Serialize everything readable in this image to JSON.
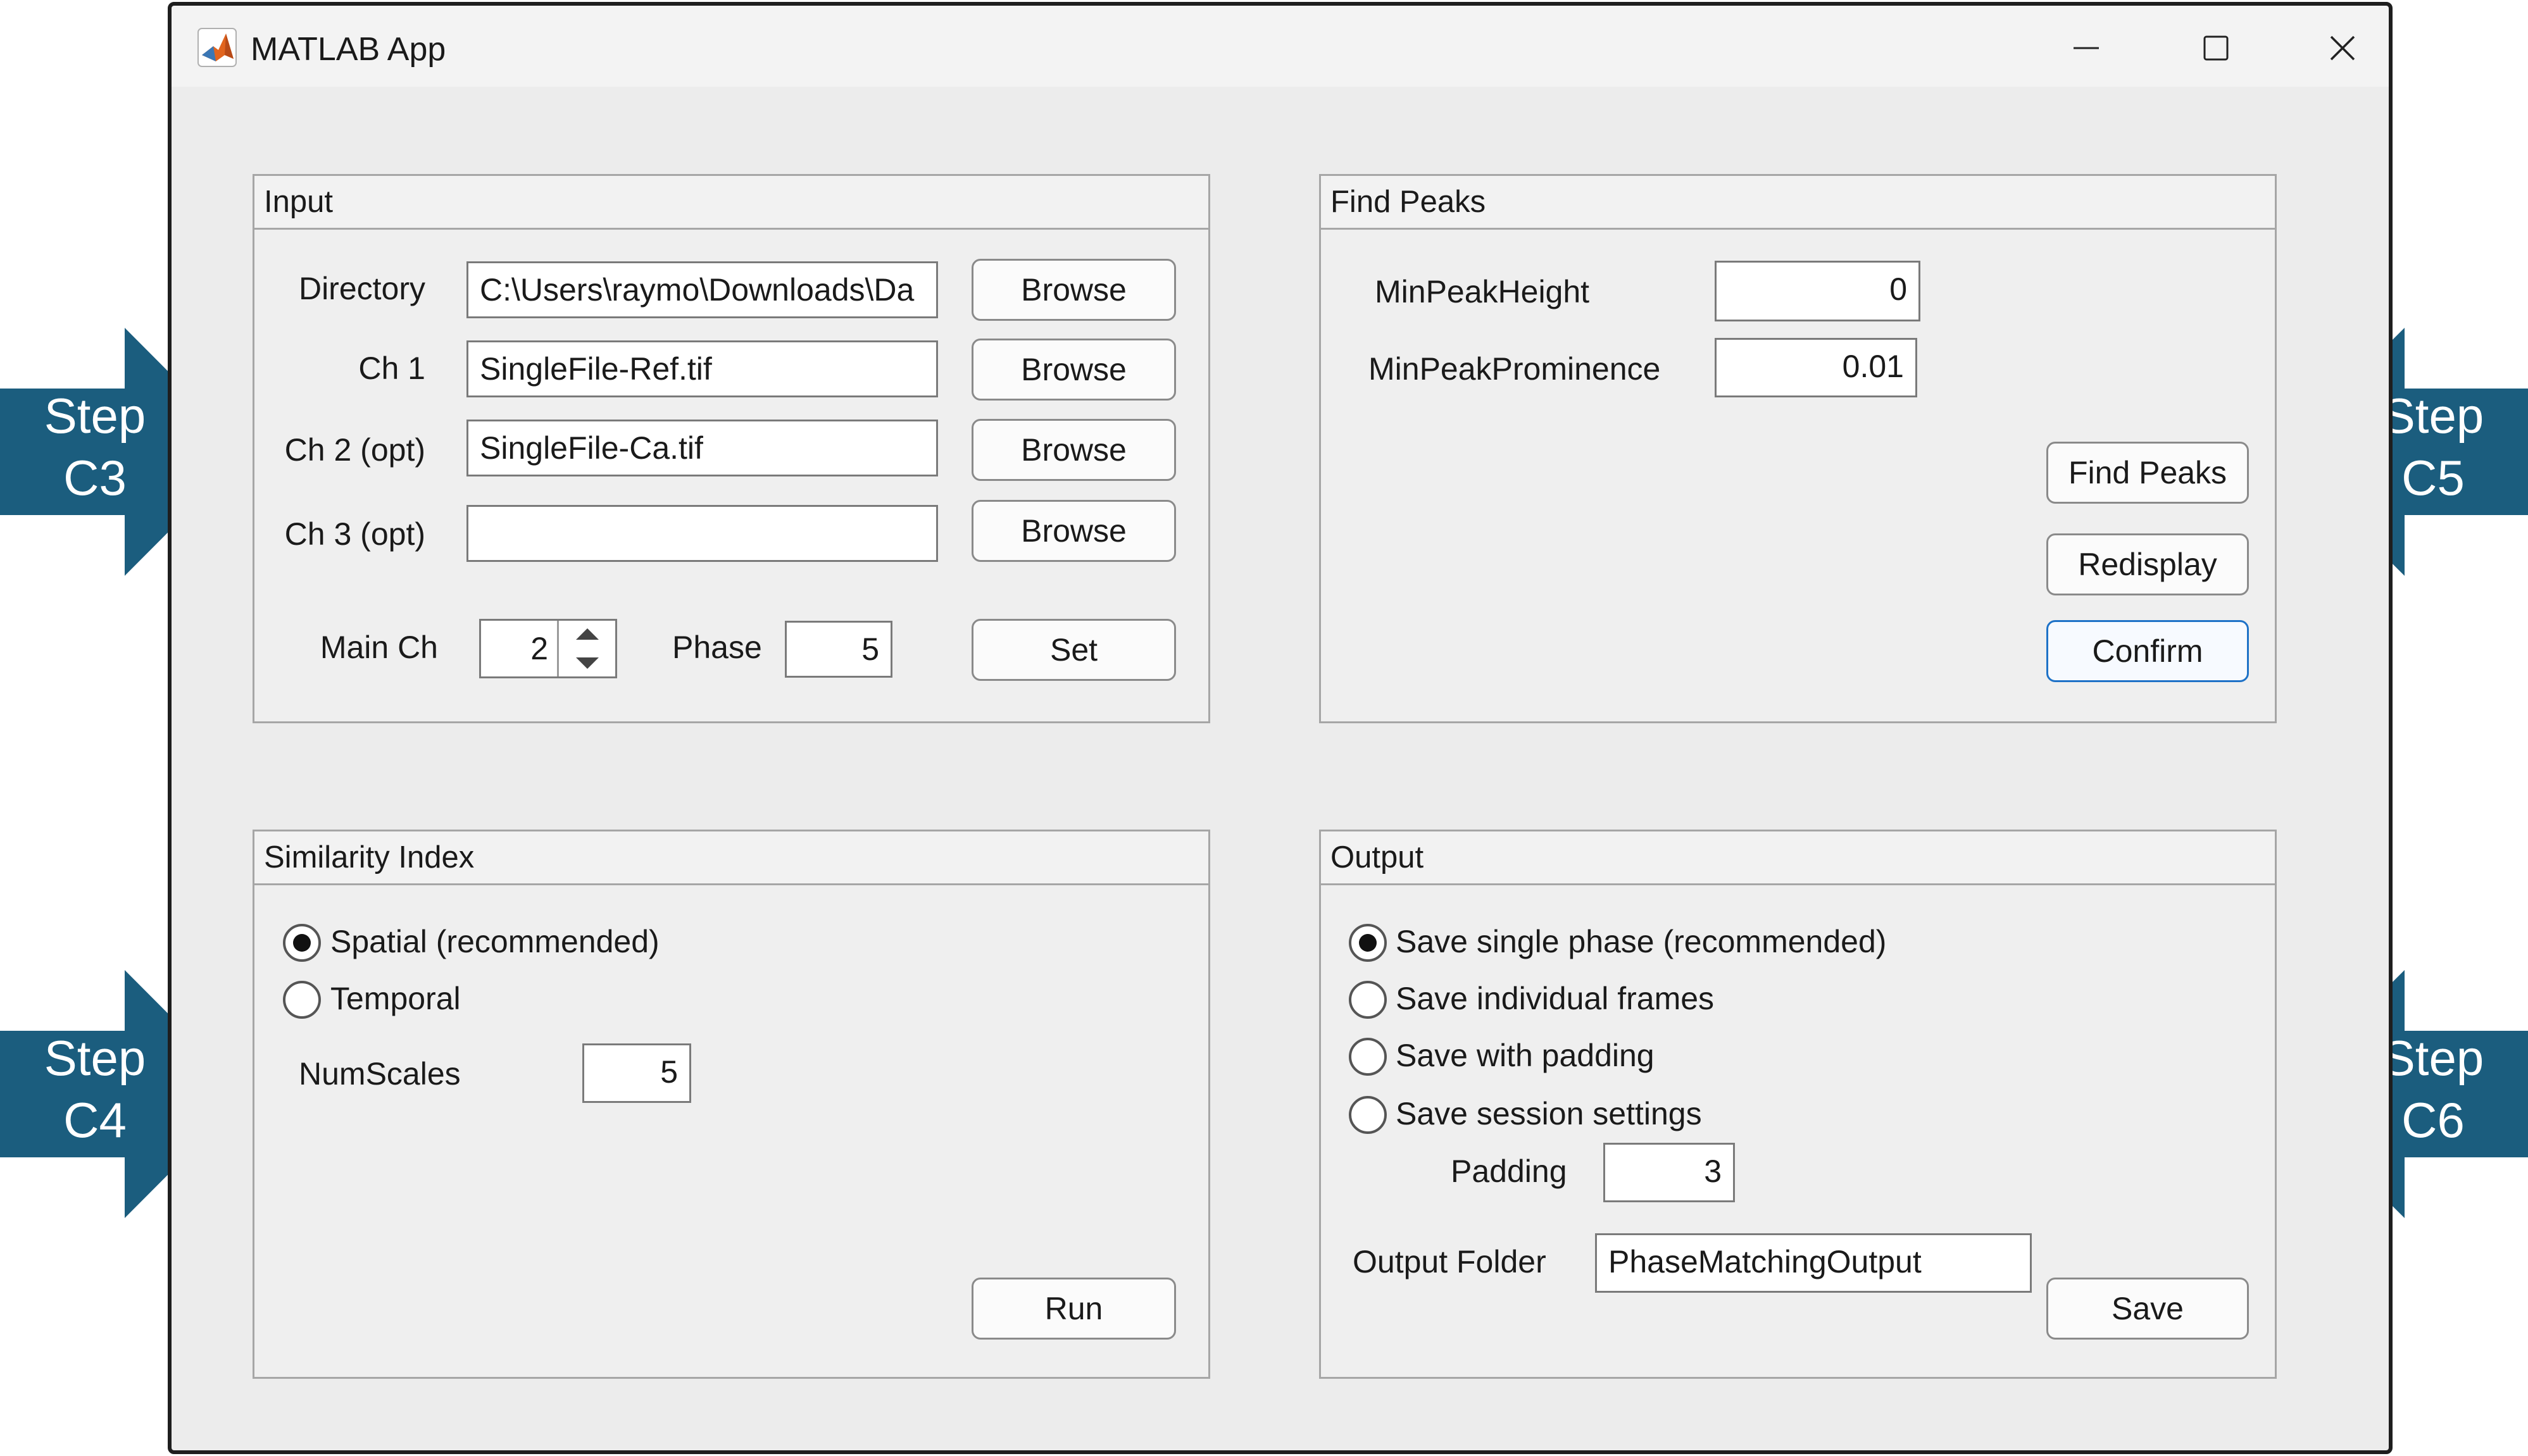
{
  "window": {
    "title": "MATLAB App",
    "icons": [
      "matlab-icon",
      "minimize-icon",
      "maximize-icon",
      "close-icon"
    ]
  },
  "input_panel": {
    "title": "Input",
    "directory_label": "Directory",
    "directory_value": "C:\\Users\\raymo\\Downloads\\Da",
    "ch1_label": "Ch 1",
    "ch1_value": "SingleFile-Ref.tif",
    "ch2_label": "Ch 2 (opt)",
    "ch2_value": "SingleFile-Ca.tif",
    "ch3_label": "Ch 3 (opt)",
    "ch3_value": "",
    "browse_label": "Browse",
    "main_ch_label": "Main Ch",
    "main_ch_value": "2",
    "phase_label": "Phase",
    "phase_value": "5",
    "set_label": "Set"
  },
  "find_peaks_panel": {
    "title": "Find Peaks",
    "min_peak_height_label": "MinPeakHeight",
    "min_peak_height_value": "0",
    "min_peak_prominence_label": "MinPeakProminence",
    "min_peak_prominence_value": "0.01",
    "find_peaks_label": "Find Peaks",
    "redisplay_label": "Redisplay",
    "confirm_label": "Confirm"
  },
  "similarity_panel": {
    "title": "Similarity Index",
    "options": [
      {
        "label": "Spatial (recommended)",
        "selected": true
      },
      {
        "label": "Temporal",
        "selected": false
      }
    ],
    "num_scales_label": "NumScales",
    "num_scales_value": "5",
    "run_label": "Run"
  },
  "output_panel": {
    "title": "Output",
    "options": [
      {
        "label": "Save single phase (recommended)",
        "selected": true
      },
      {
        "label": "Save individual frames",
        "selected": false
      },
      {
        "label": "Save with padding",
        "selected": false
      },
      {
        "label": "Save session settings",
        "selected": false
      }
    ],
    "padding_label": "Padding",
    "padding_value": "3",
    "output_folder_label": "Output Folder",
    "output_folder_value": "PhaseMatchingOutput",
    "save_label": "Save"
  },
  "steps": [
    {
      "word": "Step",
      "code": "C3"
    },
    {
      "word": "Step",
      "code": "C4"
    },
    {
      "word": "Step",
      "code": "C5"
    },
    {
      "word": "Step",
      "code": "C6"
    }
  ],
  "colors": {
    "step_arrow": "#1b5d7e",
    "window_bg": "#ececec",
    "focus_border": "#1e72c7"
  }
}
